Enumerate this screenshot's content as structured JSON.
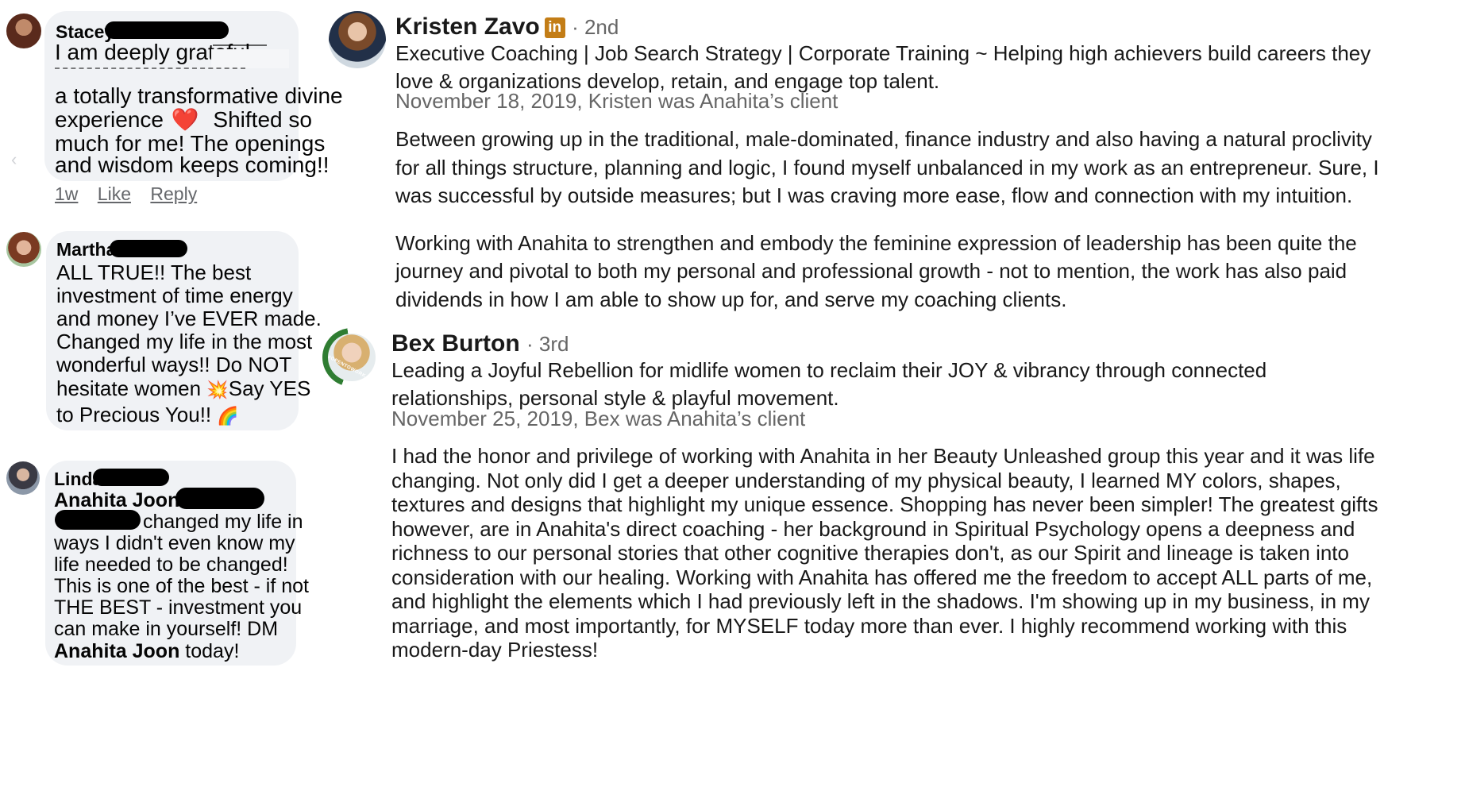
{
  "fb_comments": [
    {
      "name": "Stacey",
      "lines": [
        "I am deeply grateful",
        "a totally transformative divine",
        "experience",
        "Shifted so",
        "much for me! The openings",
        "and wisdom keeps coming!!"
      ],
      "actions": {
        "time": "1w",
        "like": "Like",
        "reply": "Reply"
      }
    },
    {
      "name": "Martha",
      "lines": [
        "ALL TRUE!! The best",
        "investment of time energy",
        "and money I’ve EVER made.",
        "Changed my life in the most",
        "wonderful ways!! Do NOT",
        "hesitate women",
        "Say YES",
        "to Precious You!!"
      ]
    },
    {
      "name": "Linda",
      "tag": "Anahita Joon",
      "lines": [
        "changed my life in",
        "ways I didn't even know my",
        "life needed to be changed!",
        "This is one of the best - if not",
        "THE BEST - investment you",
        "can make in yourself! DM"
      ],
      "closing_tag": "Anahita Joon",
      "closing_rest": " today!"
    }
  ],
  "emojis": {
    "heart": "❤️",
    "collision": "💥",
    "rainbow": "🌈"
  },
  "li_recommendations": [
    {
      "name": "Kristen Zavo",
      "badge": "in",
      "degree": "· 2nd",
      "headline_lines": [
        "Executive Coaching | Job Search Strategy | Corporate Training ~ Helping high achievers build careers they",
        "love & organizations develop, retain, and engage top talent."
      ],
      "meta": "November 18, 2019, Kristen was Anahita’s client",
      "paragraph_1": [
        "Between growing up in the traditional, male-dominated, finance industry and also having a natural proclivity",
        "for all things structure, planning and logic, I found myself unbalanced in my work as an entrepreneur. Sure, I",
        "was successful by outside measures; but I was craving more ease, flow and connection with my intuition."
      ],
      "paragraph_2": [
        "Working with Anahita to strengthen and embody the feminine expression of leadership has been quite the",
        "journey and pivotal to both my personal and professional growth - not to mention, the work has also paid",
        "dividends in how I am able to show up for, and serve my coaching clients."
      ]
    },
    {
      "name": "Bex Burton",
      "degree": "· 3rd",
      "avatar_ring_text": "#OPENTOWORK",
      "headline_lines": [
        "Leading a Joyful Rebellion for midlife women to reclaim their JOY & vibrancy through connected",
        "relationships, personal style & playful movement."
      ],
      "meta": "November 25, 2019, Bex was Anahita’s client",
      "paragraph_1": [
        "I had the honor and privilege of working with Anahita in her Beauty Unleashed group this year and it was life",
        "changing. Not only did I get a deeper understanding of my physical beauty, I learned MY colors, shapes,",
        "textures and designs that highlight my unique essence. Shopping has never been simpler! The greatest gifts",
        "however, are in Anahita's direct coaching - her background in Spiritual Psychology opens a deepness and",
        "richness to our personal stories that other cognitive therapies don't, as our Spirit and lineage is taken into",
        "consideration with our healing. Working with Anahita has offered me the freedom to accept ALL parts of me,",
        "and highlight the elements which I had previously left in the shadows. I'm showing up in my business, in my",
        "marriage, and most importantly, for MYSELF today more than ever. I highly recommend working with this",
        "modern-day Priestess!"
      ]
    }
  ],
  "colors": {
    "bubble": "#f0f2f5",
    "muted": "#666666",
    "li_badge": "#c37d16",
    "open_to_work": "#2f7d32"
  }
}
